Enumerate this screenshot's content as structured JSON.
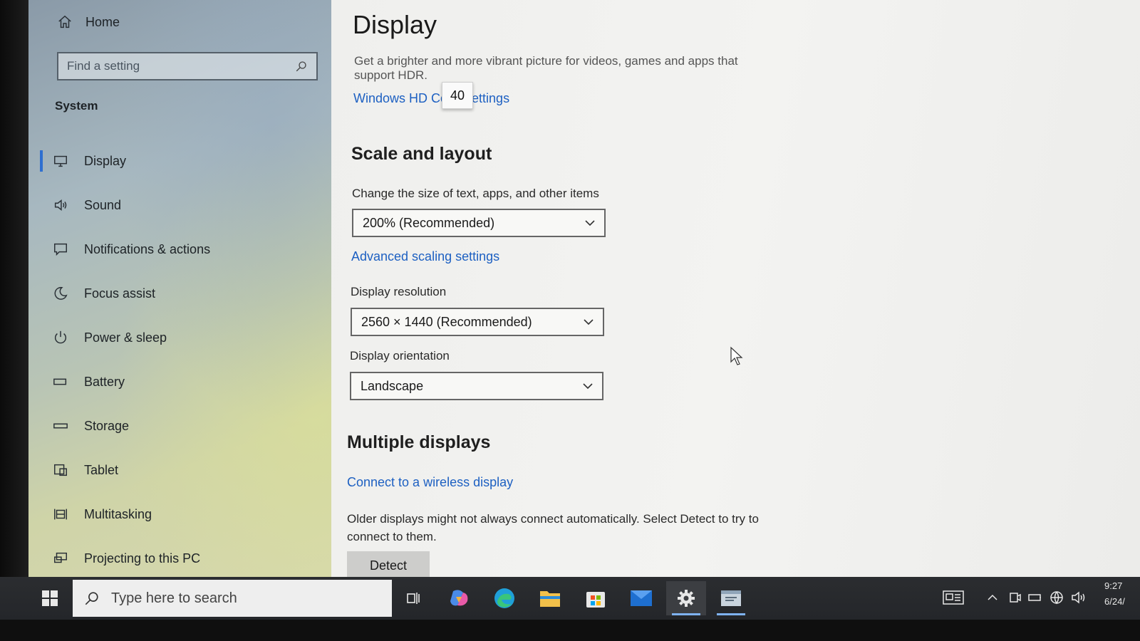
{
  "sidebar": {
    "home_label": "Home",
    "search_placeholder": "Find a setting",
    "section_label": "System",
    "items": [
      {
        "label": "Display",
        "icon": "monitor-icon",
        "active": true
      },
      {
        "label": "Sound",
        "icon": "speaker-icon"
      },
      {
        "label": "Notifications & actions",
        "icon": "notification-icon"
      },
      {
        "label": "Focus assist",
        "icon": "moon-icon"
      },
      {
        "label": "Power & sleep",
        "icon": "power-icon"
      },
      {
        "label": "Battery",
        "icon": "battery-icon"
      },
      {
        "label": "Storage",
        "icon": "storage-icon"
      },
      {
        "label": "Tablet",
        "icon": "tablet-icon"
      },
      {
        "label": "Multitasking",
        "icon": "multitasking-icon"
      },
      {
        "label": "Projecting to this PC",
        "icon": "projecting-icon"
      }
    ]
  },
  "main": {
    "title": "Display",
    "hdr_description": "Get a brighter and more vibrant picture for videos, games and apps that support HDR.",
    "hd_color_link": "Windows HD Color settings",
    "tooltip_value": "40",
    "scale_section_title": "Scale and layout",
    "scale_label": "Change the size of text, apps, and other items",
    "scale_value": "200% (Recommended)",
    "advanced_scaling_link": "Advanced scaling settings",
    "resolution_label": "Display resolution",
    "resolution_value": "2560 × 1440 (Recommended)",
    "orientation_label": "Display orientation",
    "orientation_value": "Landscape",
    "multiple_section_title": "Multiple displays",
    "wireless_link": "Connect to a wireless display",
    "older_description": "Older displays might not always connect automatically. Select Detect to try to connect to them.",
    "detect_button": "Detect"
  },
  "taskbar": {
    "search_placeholder": "Type here to search",
    "pinned": [
      "task-view-icon",
      "copilot-icon",
      "edge-icon",
      "file-explorer-icon",
      "store-icon",
      "mail-icon",
      "settings-icon",
      "app-window-icon"
    ],
    "clock_time": "9:27",
    "clock_date": "6/24/"
  },
  "colors": {
    "accent": "#1d60c2",
    "taskbar": "#2b2d30",
    "active_indicator": "#7fb2f0"
  }
}
